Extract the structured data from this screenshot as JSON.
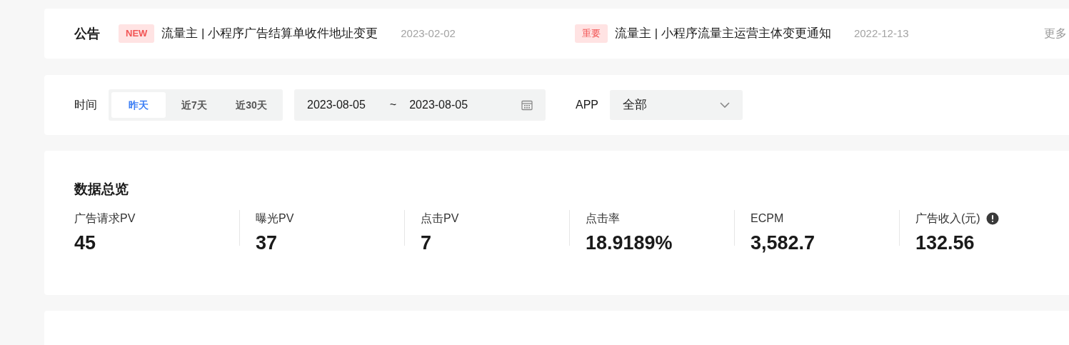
{
  "announcements": {
    "title": "公告",
    "items": [
      {
        "tag": "NEW",
        "kind": "new",
        "text": "流量主 | 小程序广告结算单收件地址变更",
        "date": "2023-02-02"
      },
      {
        "tag": "重要",
        "kind": "important",
        "text": "流量主 | 小程序流量主运营主体变更通知",
        "date": "2022-12-13"
      }
    ],
    "more": "更多"
  },
  "filters": {
    "time_label": "时间",
    "ranges": [
      {
        "label": "昨天",
        "selected": true
      },
      {
        "label": "近7天",
        "selected": false
      },
      {
        "label": "近30天",
        "selected": false
      }
    ],
    "date_start": "2023-08-05",
    "date_sep": "~",
    "date_end": "2023-08-05",
    "app_label": "APP",
    "app_value": "全部"
  },
  "overview": {
    "title": "数据总览",
    "metrics": [
      {
        "label": "广告请求PV",
        "value": "45",
        "info": false
      },
      {
        "label": "曝光PV",
        "value": "37",
        "info": false
      },
      {
        "label": "点击PV",
        "value": "7",
        "info": false
      },
      {
        "label": "点击率",
        "value": "18.9189%",
        "info": false
      },
      {
        "label": "ECPM",
        "value": "3,582.7",
        "info": false
      },
      {
        "label": "广告收入(元)",
        "value": "132.56",
        "info": true
      }
    ]
  }
}
